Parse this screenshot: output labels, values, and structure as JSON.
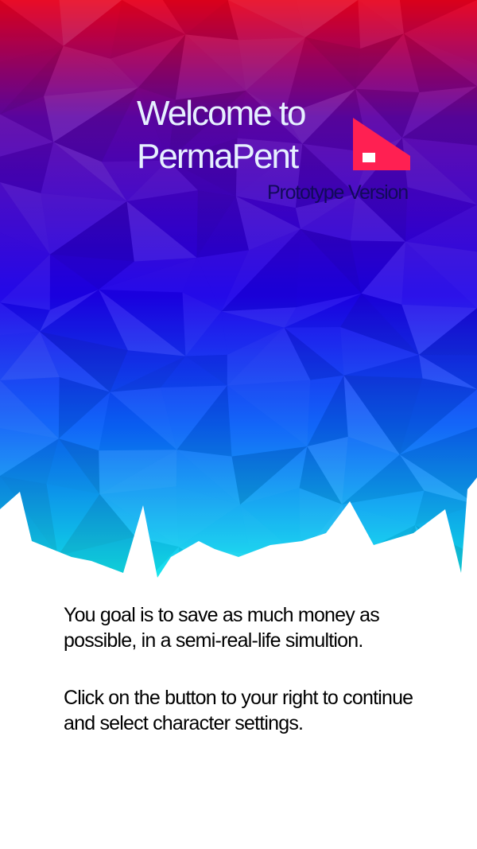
{
  "header": {
    "title_line_1": "Welcome to",
    "title_line_2": "PermaPent",
    "subtitle": "Prototype Version"
  },
  "logo": {
    "icon": "permapent-logo-icon"
  },
  "body": {
    "paragraph_1": "You goal is to save as much money as possible, in a semi-real-life simultion.",
    "paragraph_2": "Click on the button to your right to continue and select character settings."
  },
  "colors": {
    "top": "#e8001c",
    "upper_mid": "#5e05a8",
    "mid": "#1c00e8",
    "lower_mid": "#0a5ff8",
    "bottom": "#12f0ec",
    "logo_fill": "#ff2052",
    "background": "#ffffff"
  }
}
